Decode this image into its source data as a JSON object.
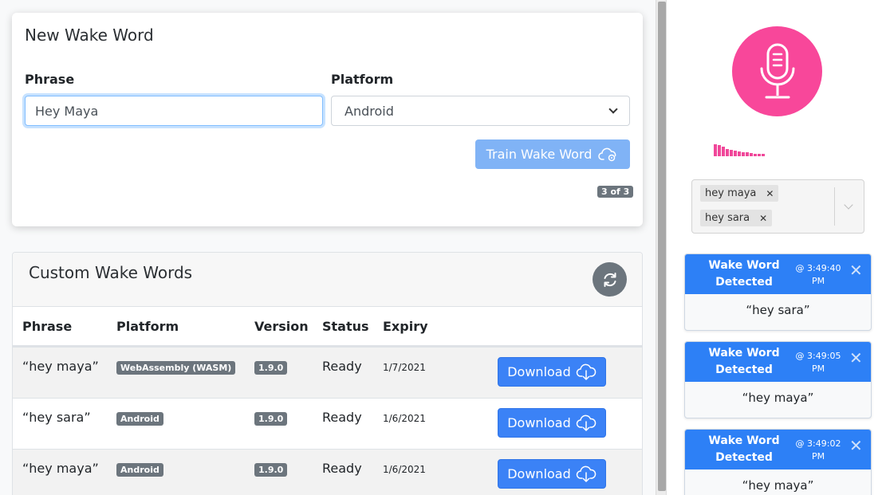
{
  "new_wake_word": {
    "title": "New Wake Word",
    "phrase_label": "Phrase",
    "phrase_value": "Hey Maya",
    "platform_label": "Platform",
    "platform_value": "Android",
    "train_button": "Train Wake Word",
    "count_badge": "3 of 3"
  },
  "custom_wake_words": {
    "title": "Custom Wake Words",
    "columns": [
      "Phrase",
      "Platform",
      "Version",
      "Status",
      "Expiry"
    ],
    "rows": [
      {
        "phrase": "“hey maya”",
        "platform": "WebAssembly (WASM)",
        "version": "1.9.0",
        "status": "Ready",
        "expiry": "1/7/2021",
        "action": "Download"
      },
      {
        "phrase": "“hey sara”",
        "platform": "Android",
        "version": "1.9.0",
        "status": "Ready",
        "expiry": "1/6/2021",
        "action": "Download"
      },
      {
        "phrase": "“hey maya”",
        "platform": "Android",
        "version": "1.9.0",
        "status": "Ready",
        "expiry": "1/6/2021",
        "action": "Download"
      }
    ]
  },
  "listener": {
    "mic_icon": "microphone-icon",
    "level_color": "#f0489a",
    "mic_color": "#f8479a",
    "active_words": [
      "hey maya",
      "hey sara"
    ]
  },
  "detections": [
    {
      "title": "Wake Word Detected",
      "time": "@ 3:49:40 PM",
      "word": "“hey sara”"
    },
    {
      "title": "Wake Word Detected",
      "time": "@ 3:49:05 PM",
      "word": "“hey maya”"
    },
    {
      "title": "Wake Word Detected",
      "time": "@ 3:49:02 PM",
      "word": "“hey maya”"
    }
  ],
  "colors": {
    "primary": "#3b82f6",
    "primary_disabled": "#80b3f6",
    "toast_header": "#2d80f6",
    "badge": "#6c757d"
  }
}
